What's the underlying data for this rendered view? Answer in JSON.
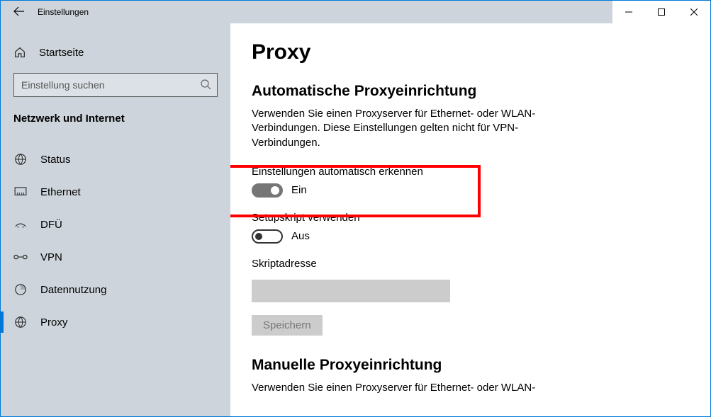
{
  "window": {
    "title": "Einstellungen"
  },
  "sidebar": {
    "home_label": "Startseite",
    "search_placeholder": "Einstellung suchen",
    "category": "Netzwerk und Internet",
    "items": [
      {
        "label": "Status"
      },
      {
        "label": "Ethernet"
      },
      {
        "label": "DFÜ"
      },
      {
        "label": "VPN"
      },
      {
        "label": "Datennutzung"
      },
      {
        "label": "Proxy"
      }
    ]
  },
  "main": {
    "page_title": "Proxy",
    "auto_section": {
      "heading": "Automatische Proxyeinrichtung",
      "description": "Verwenden Sie einen Proxyserver für Ethernet- oder WLAN-Verbindungen. Diese Einstellungen gelten nicht für VPN-Verbindungen.",
      "detect": {
        "label": "Einstellungen automatisch erkennen",
        "state": "Ein"
      },
      "script": {
        "label": "Setupskript verwenden",
        "state": "Aus"
      },
      "script_address_label": "Skriptadresse",
      "save_label": "Speichern"
    },
    "manual_section": {
      "heading": "Manuelle Proxyeinrichtung",
      "description": "Verwenden Sie einen Proxyserver für Ethernet- oder WLAN-"
    }
  }
}
